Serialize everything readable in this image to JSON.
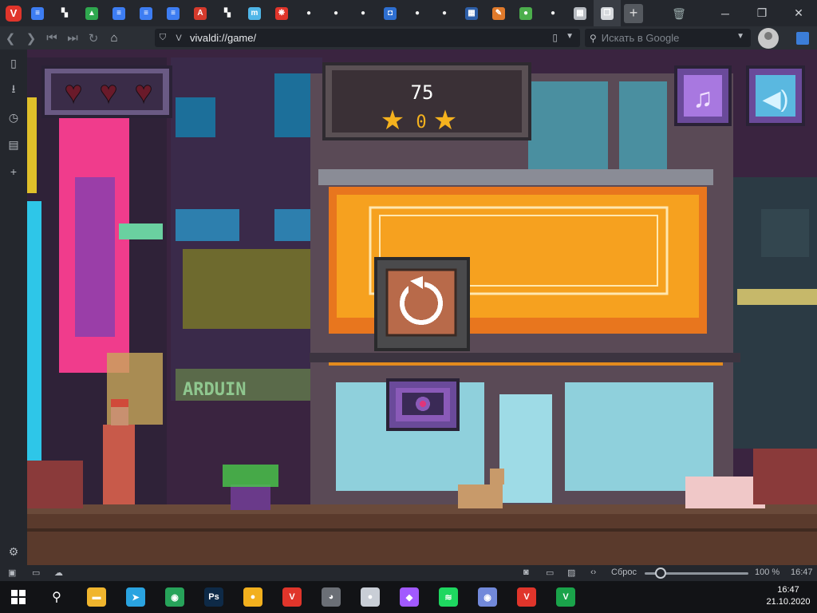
{
  "app": {
    "title": "Vivaldi",
    "logo_letter": "V"
  },
  "tabs": [
    {
      "icon": "google-docs-icon",
      "color": "#3d7df2",
      "glyph": "≡"
    },
    {
      "icon": "chess-icon",
      "color": "#ffffff",
      "glyph": "▚"
    },
    {
      "icon": "google-drive-icon",
      "color": "#2fa84f",
      "glyph": "▲"
    },
    {
      "icon": "google-docs-icon",
      "color": "#3d7df2",
      "glyph": "≡"
    },
    {
      "icon": "google-docs-icon",
      "color": "#3d7df2",
      "glyph": "≡"
    },
    {
      "icon": "google-docs-icon",
      "color": "#3d7df2",
      "glyph": "≡"
    },
    {
      "icon": "pdf-icon",
      "color": "#d53a2c",
      "glyph": "A"
    },
    {
      "icon": "chess-icon",
      "color": "#ffffff",
      "glyph": "▚"
    },
    {
      "icon": "mega-icon",
      "color": "#4fb6e8",
      "glyph": "m"
    },
    {
      "icon": "paw-icon",
      "color": "#e0352b",
      "glyph": "❋"
    },
    {
      "icon": "github-icon",
      "color": "#f0f0f0",
      "glyph": "●"
    },
    {
      "icon": "github-icon",
      "color": "#f0f0f0",
      "glyph": "●"
    },
    {
      "icon": "github-icon",
      "color": "#f0f0f0",
      "glyph": "●"
    },
    {
      "icon": "shield-blue-icon",
      "color": "#2e6fd1",
      "glyph": "◘"
    },
    {
      "icon": "github-icon",
      "color": "#f0f0f0",
      "glyph": "●"
    },
    {
      "icon": "github-icon",
      "color": "#f0f0f0",
      "glyph": "●"
    },
    {
      "icon": "msn-icon",
      "color": "#2e5fa8",
      "glyph": "▦"
    },
    {
      "icon": "pen-icon",
      "color": "#e07a2b",
      "glyph": "✎"
    },
    {
      "icon": "leaf-icon",
      "color": "#4cae4c",
      "glyph": "●"
    },
    {
      "icon": "github-icon",
      "color": "#f0f0f0",
      "glyph": "●"
    },
    {
      "icon": "apps-grid-icon",
      "color": "#b7bbc1",
      "glyph": "▦"
    },
    {
      "icon": "tab-stack-icon",
      "color": "#d6d9dd",
      "glyph": "❐"
    }
  ],
  "nav": {
    "url": "vivaldi://game/",
    "search_placeholder": "Искать в Google"
  },
  "sidebar": [
    "bookmark-icon",
    "download-icon",
    "history-icon",
    "notes-icon",
    "add-panel-icon"
  ],
  "game": {
    "score": "75",
    "stars_count": "0",
    "lives": 3,
    "sign_text": "ARDUIN"
  },
  "status": {
    "reset_label": "Сброс",
    "zoom": "100 %",
    "time": "16:47",
    "zoom_level": 0.15
  },
  "taskbar": {
    "apps": [
      {
        "name": "file-explorer-icon",
        "color": "#f0b52e",
        "glyph": "▬"
      },
      {
        "name": "telegram-icon",
        "color": "#2aa3e0",
        "glyph": "➤"
      },
      {
        "name": "maps-icon",
        "color": "#27a35a",
        "glyph": "◉"
      },
      {
        "name": "photoshop-icon",
        "color": "#0e2a47",
        "glyph": "Ps"
      },
      {
        "name": "chrome-canary-icon",
        "color": "#f2b01e",
        "glyph": "●"
      },
      {
        "name": "vivaldi-icon",
        "color": "#e0352b",
        "glyph": "V"
      },
      {
        "name": "raccoon-icon",
        "color": "#6b6f76",
        "glyph": "◕"
      },
      {
        "name": "moon-icon",
        "color": "#c9ced6",
        "glyph": "●"
      },
      {
        "name": "figma-icon",
        "color": "#a259ff",
        "glyph": "◆"
      },
      {
        "name": "spotify-icon",
        "color": "#1ed760",
        "glyph": "≋"
      },
      {
        "name": "discord-icon",
        "color": "#7289da",
        "glyph": "◉"
      },
      {
        "name": "vivaldi-icon-2",
        "color": "#e0352b",
        "glyph": "V"
      },
      {
        "name": "vivaldi-snapshot-icon",
        "color": "#1aa34a",
        "glyph": "V"
      }
    ],
    "time": "16:47",
    "date": "21.10.2020"
  }
}
